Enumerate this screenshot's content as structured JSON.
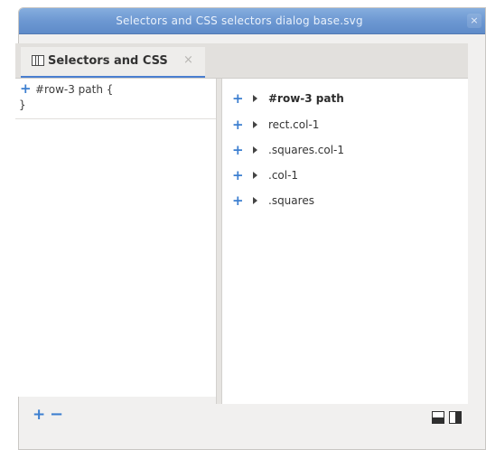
{
  "window": {
    "title": "Selectors and CSS  selectors  dialog  base.svg",
    "close_glyph": "×"
  },
  "tab": {
    "label": "Selectors and CSS",
    "close_glyph": "×",
    "icon": "panel-icon"
  },
  "left_pane": {
    "rule": {
      "add_glyph": "+",
      "selector": "#row-3 path {",
      "closing": "}"
    },
    "footer": {
      "add_glyph": "+",
      "remove_glyph": "−"
    }
  },
  "right_pane": {
    "items": [
      {
        "label": "#row-3 path",
        "bold": true
      },
      {
        "label": "rect.col-1",
        "bold": false
      },
      {
        "label": ".squares.col-1",
        "bold": false
      },
      {
        "label": ".col-1",
        "bold": false
      },
      {
        "label": ".squares",
        "bold": false
      }
    ],
    "add_glyph": "+"
  },
  "layout_buttons": {
    "horizontal": "layout-horizontal-icon",
    "vertical": "layout-vertical-icon"
  },
  "colors": {
    "accent": "#3d7fd0",
    "titlebar": "#6d98d2",
    "tab_underline": "#4a7fd0"
  }
}
